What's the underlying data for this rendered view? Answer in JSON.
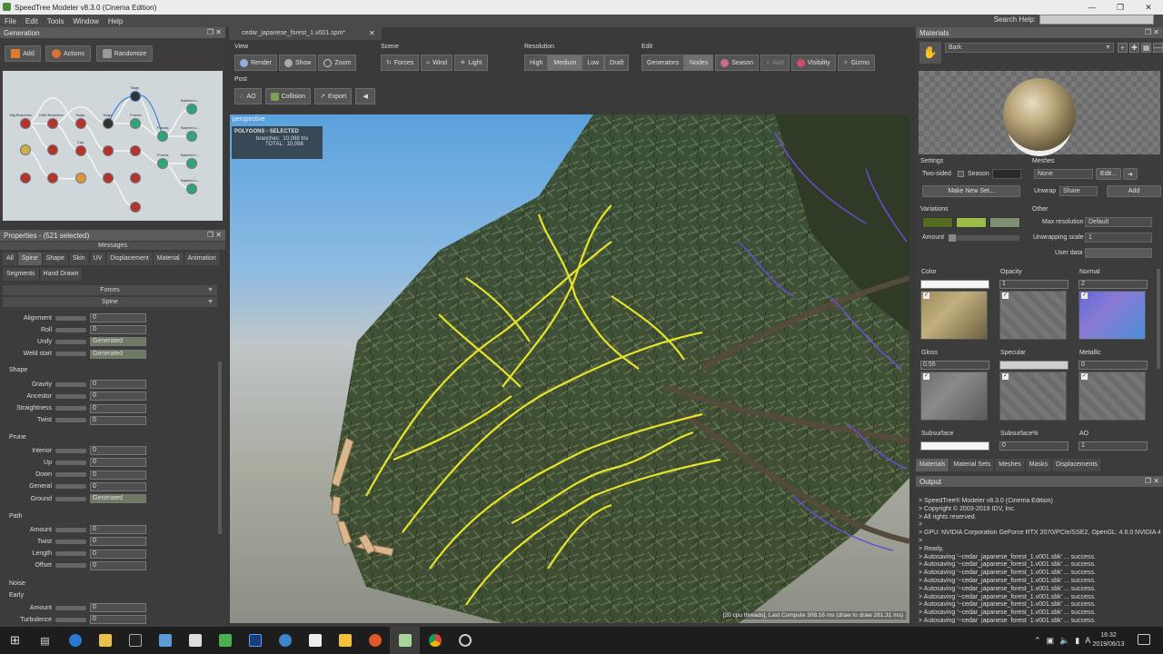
{
  "app": {
    "title": "SpeedTree Modeler v8.3.0 (Cinema Edition)"
  },
  "menu": [
    "File",
    "Edit",
    "Tools",
    "Window",
    "Help"
  ],
  "search_help": "Search Help:",
  "generation": {
    "title": "Generation",
    "add": "Add",
    "actions": "Actions",
    "randomize": "Randomize",
    "nodes": [
      "Big Branches",
      "Little Branches",
      "Twigs",
      "Twigs",
      "Twigs",
      "Batched L...",
      "Batched L...",
      "Batched L...",
      "Batched L...",
      "Fronds",
      "Fronds",
      "Fronds",
      "Cap"
    ]
  },
  "properties": {
    "title": "Properties - (521 selected)",
    "messages": "Messages",
    "tabs": [
      "All",
      "Spine",
      "Shape",
      "Skin",
      "UV",
      "Displacement",
      "Material",
      "Animation"
    ],
    "tabs2": [
      "Segments",
      "Hand Drawn"
    ],
    "group_forces": "Forces",
    "group_spine": "Spine",
    "rows_top": [
      {
        "label": "Alignment",
        "value": "0"
      },
      {
        "label": "Roll",
        "value": "0"
      },
      {
        "label": "Unify",
        "value": "Generated"
      },
      {
        "label": "Weld start",
        "value": "Generated"
      }
    ],
    "shape_title": "Shape",
    "rows_shape": [
      {
        "label": "Gravity",
        "value": "0"
      },
      {
        "label": "Ancestor",
        "value": "0"
      },
      {
        "label": "Straightness",
        "value": "0"
      },
      {
        "label": "Twist",
        "value": "0"
      }
    ],
    "prune_title": "Prune",
    "rows_prune": [
      {
        "label": "Interior",
        "value": "0"
      },
      {
        "label": "Up",
        "value": "0"
      },
      {
        "label": "Down",
        "value": "0"
      },
      {
        "label": "General",
        "value": "0"
      },
      {
        "label": "Ground",
        "value": "Generated"
      }
    ],
    "path_title": "Path",
    "rows_path": [
      {
        "label": "Amount",
        "value": "0"
      },
      {
        "label": "Twist",
        "value": "0"
      },
      {
        "label": "Length",
        "value": "0"
      },
      {
        "label": "Offset",
        "value": "0"
      }
    ],
    "noise_title": "Noise",
    "early_title": "Early",
    "rows_noise": [
      {
        "label": "Amount",
        "value": "0"
      },
      {
        "label": "Turbulence",
        "value": "0"
      }
    ]
  },
  "viewport": {
    "tab": "cedar_japanese_forest_1.v001.spm*",
    "groups": {
      "view": "View",
      "scene": "Scene",
      "resolution": "Resolution",
      "edit": "Edit",
      "post": "Post"
    },
    "view_buttons": [
      "Render",
      "Show",
      "Zoom"
    ],
    "scene_buttons": [
      "Forces",
      "Wind",
      "Light"
    ],
    "resolution_buttons": [
      "High",
      "Medium",
      "Low",
      "Draft"
    ],
    "edit_buttons": [
      "Generators",
      "Nodes",
      "Season",
      "Add",
      "Visibility",
      "Gizmo"
    ],
    "post_buttons": [
      "AO",
      "Collision",
      "Export"
    ],
    "perspective": "perspective",
    "poly_title": "POLYGONS - SELECTED",
    "poly_branches_label": "branches:",
    "poly_branches": "10,098 tris",
    "poly_total_label": "TOTAL:",
    "poly_total": "10,098",
    "status": "[20 cpu threads], Last Compute 308.16 ms (draw to draw 281.31 ms)"
  },
  "materials": {
    "title": "Materials",
    "selected": "Bark",
    "settings": "Settings",
    "two_sided": "Two-sided",
    "season": "Season",
    "make_new_set": "Make New Set...",
    "meshes": "Meshes",
    "meshes_value": "None",
    "edit_btn": "Edit...",
    "unwrap": "Unwrap",
    "unwrap_value": "Share",
    "add": "Add",
    "variations": "Variations",
    "amount": "Amount",
    "other": "Other",
    "max_resolution": "Max resolution",
    "max_resolution_value": "Default",
    "unwrapping_scale": "Unwrapping scale",
    "unwrapping_scale_value": "1",
    "user_data": "User data",
    "channels": [
      {
        "label": "Color",
        "value": ""
      },
      {
        "label": "Opacity",
        "value": "1"
      },
      {
        "label": "Normal",
        "value": "2"
      },
      {
        "label": "Gloss",
        "value": "0.55"
      },
      {
        "label": "Specular",
        "value": ""
      },
      {
        "label": "Metallic",
        "value": "0"
      },
      {
        "label": "Subsurface",
        "value": ""
      },
      {
        "label": "Subsurface%",
        "value": "0"
      },
      {
        "label": "AO",
        "value": "1"
      }
    ],
    "bottom_tabs": [
      "Materials",
      "Material Sets",
      "Meshes",
      "Masks",
      "Displacements"
    ],
    "colors": {
      "variation1": "#556b1f",
      "variation2": "#9cbb48",
      "variation3": "#7f8f72"
    }
  },
  "output": {
    "title": "Output",
    "lines": [
      "> SpeedTree® Modeler v8.3.0 (Cinema Edition)",
      "> Copyright © 2003-2019 IDV, Inc.",
      ">   All rights reserved.",
      ">",
      "> GPU: NVIDIA Corporation GeForce RTX 2070/PCIe/SSE2, OpenGL: 4.6.0 NVIDIA 4",
      ">",
      "> Ready.",
      "> Autosaving '~cedar_japanese_forest_1.v001.sbk' ... success.",
      "> Autosaving '~cedar_japanese_forest_1.v001.sbk' ... success.",
      "> Autosaving '~cedar_japanese_forest_1.v001.sbk' ... success.",
      "> Autosaving '~cedar_japanese_forest_1.v001.sbk' ... success.",
      "> Autosaving '~cedar_japanese_forest_1.v001.sbk' ... success.",
      "> Autosaving '~cedar_japanese_forest_1.v001.sbk' ... success.",
      "> Autosaving '~cedar_japanese_forest_1.v001.sbk' ... success.",
      "> Autosaving '~cedar_japanese_forest_1.v001.sbk' ... success.",
      "> Autosaving '~cedar_japanese_forest_1.v001.sbk' ... success.",
      "> Autosaving '~cedar_japanese_forest_1.v001.sbk' ... success."
    ]
  },
  "taskbar": {
    "time": "16:32",
    "date": "2019/06/13",
    "lang": "A"
  }
}
